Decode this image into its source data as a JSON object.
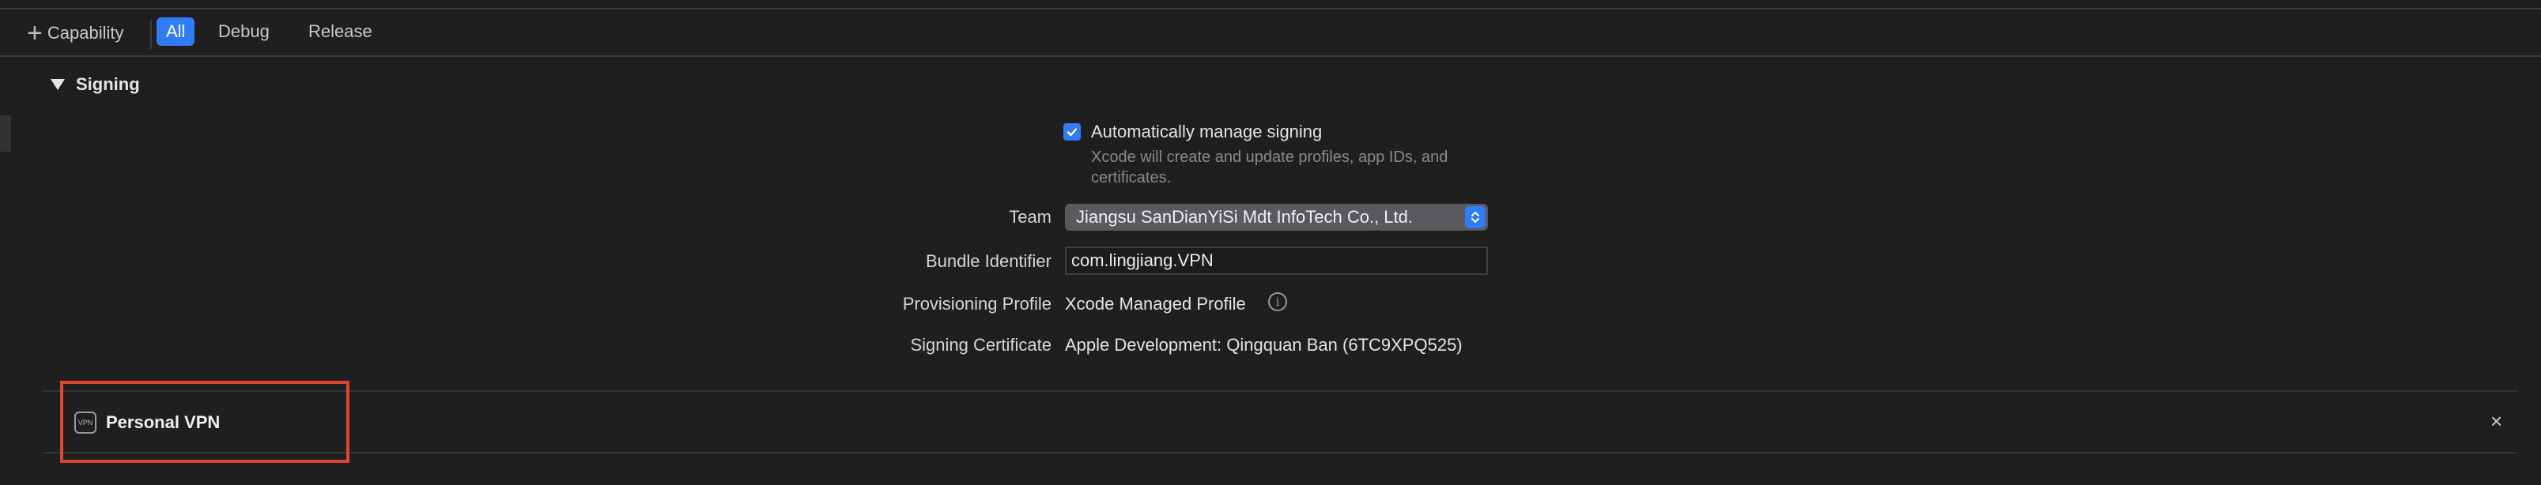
{
  "toolbar": {
    "add_capability_label": "Capability",
    "tabs": [
      {
        "label": "All",
        "active": true
      },
      {
        "label": "Debug",
        "active": false
      },
      {
        "label": "Release",
        "active": false
      }
    ]
  },
  "signing": {
    "section_title": "Signing",
    "auto_manage": {
      "checked": true,
      "label": "Automatically manage signing",
      "help": "Xcode will create and update profiles, app IDs, and certificates."
    },
    "team": {
      "label": "Team",
      "value": "Jiangsu SanDianYiSi Mdt InfoTech Co., Ltd."
    },
    "bundle_identifier": {
      "label": "Bundle Identifier",
      "value": "com.lingjiang.VPN"
    },
    "provisioning_profile": {
      "label": "Provisioning Profile",
      "value": "Xcode Managed Profile"
    },
    "signing_certificate": {
      "label": "Signing Certificate",
      "value": "Apple Development: Qingquan Ban (6TC9XPQ525)"
    }
  },
  "capability": {
    "icon_text": "VPN",
    "title": "Personal VPN",
    "close_glyph": "×"
  },
  "colors": {
    "accent": "#2f7cf6",
    "highlight": "#e0432f",
    "background": "#1f1f20"
  },
  "icons": [
    "plus-icon",
    "disclosure-triangle-icon",
    "checkmark-icon",
    "popup-stepper-icon",
    "info-icon",
    "vpn-icon",
    "close-icon"
  ]
}
